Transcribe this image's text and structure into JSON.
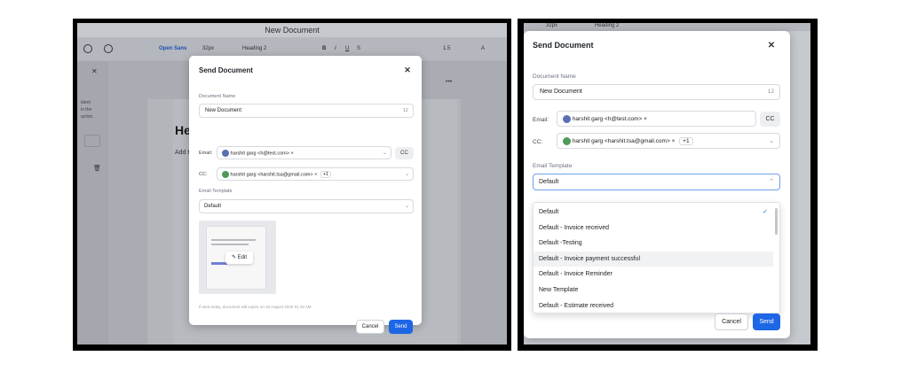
{
  "editor": {
    "title": "New Document",
    "font": "Open Sans",
    "size": "32px",
    "heading": "Heading 2",
    "line_height": "1.5",
    "doc_heading": "He",
    "doc_text": "Add t",
    "side_text": [
      "ident",
      "in the",
      "action."
    ],
    "more": "•••"
  },
  "modal": {
    "title": "Send Document",
    "close_icon": "✕",
    "document_name_label": "Document Name",
    "document_name_value": "New Document",
    "document_name_count": "12",
    "email_label": "Email:",
    "email_chip": "harshit garg <h@test.com>",
    "chip_remove": "×",
    "cc_button": "CC",
    "cc_label": "CC:",
    "cc_chip": "harshit garg <harshit.tsa@gmail.com>",
    "cc_more": "+1",
    "template_label": "Email Template",
    "template_value": "Default",
    "edit_label": "Edit",
    "expiry_note": "If sent today, document will expire on 16 August 2025 01:43 AM",
    "cancel_label": "Cancel",
    "send_label": "Send"
  },
  "template_options": [
    "Default",
    "Default - Invoice received",
    "Default -Testing",
    "Default - Invoice payment successful",
    "Default - Invoice Reminder",
    "New Template",
    "Default - Estimate received"
  ],
  "selected_check": "✓",
  "colors": {
    "accent": "#1d66e5",
    "avatar_email": "#5b6fb3",
    "avatar_cc": "#4e9a5a"
  }
}
